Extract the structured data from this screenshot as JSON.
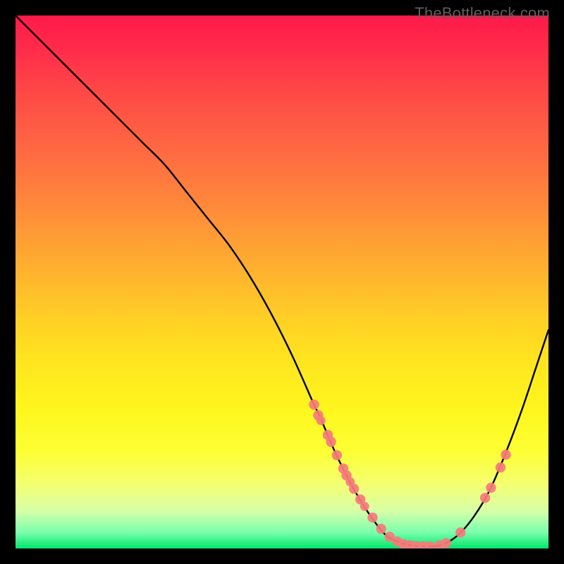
{
  "watermark": "TheBottleneck.com",
  "chart_data": {
    "type": "line",
    "title": "",
    "xlabel": "",
    "ylabel": "",
    "xlim": [
      0,
      100
    ],
    "ylim": [
      0,
      100
    ],
    "series": [
      {
        "name": "curve",
        "x": [
          0,
          4,
          8,
          12,
          16,
          20,
          24,
          28,
          32,
          36,
          40,
          44,
          48,
          52,
          56,
          57,
          60,
          63,
          66,
          69,
          71,
          74,
          77,
          80,
          83,
          86,
          89,
          92,
          95,
          98,
          100
        ],
        "y": [
          100,
          96,
          92,
          88,
          84,
          80,
          76,
          72,
          67,
          62,
          57,
          51,
          44,
          36,
          27,
          25,
          18,
          12,
          7,
          3,
          1.6,
          0.6,
          0.4,
          0.7,
          2.5,
          6,
          11,
          18,
          26,
          35,
          41
        ]
      }
    ],
    "markers": {
      "name": "highlighted-points",
      "color": "#f77a7c",
      "points": [
        {
          "x": 56.0,
          "y": 27.0,
          "r": 1.0
        },
        {
          "x": 56.8,
          "y": 25.0,
          "r": 1.0
        },
        {
          "x": 57.3,
          "y": 24.0,
          "r": 0.9
        },
        {
          "x": 58.6,
          "y": 21.3,
          "r": 1.0
        },
        {
          "x": 59.2,
          "y": 20.0,
          "r": 1.0
        },
        {
          "x": 60.3,
          "y": 17.5,
          "r": 1.0
        },
        {
          "x": 61.5,
          "y": 15.0,
          "r": 1.0
        },
        {
          "x": 62.1,
          "y": 13.7,
          "r": 1.0
        },
        {
          "x": 62.8,
          "y": 12.5,
          "r": 0.9
        },
        {
          "x": 63.5,
          "y": 11.2,
          "r": 1.0
        },
        {
          "x": 64.7,
          "y": 9.2,
          "r": 1.0
        },
        {
          "x": 65.5,
          "y": 7.9,
          "r": 0.9
        },
        {
          "x": 67.0,
          "y": 5.8,
          "r": 1.0
        },
        {
          "x": 68.6,
          "y": 3.7,
          "r": 1.0
        },
        {
          "x": 70.2,
          "y": 2.2,
          "r": 1.0
        },
        {
          "x": 71.6,
          "y": 1.3,
          "r": 1.0
        },
        {
          "x": 72.8,
          "y": 0.8,
          "r": 1.0
        },
        {
          "x": 74.0,
          "y": 0.6,
          "r": 1.0
        },
        {
          "x": 75.2,
          "y": 0.45,
          "r": 1.0
        },
        {
          "x": 76.5,
          "y": 0.4,
          "r": 1.0
        },
        {
          "x": 77.8,
          "y": 0.4,
          "r": 1.0
        },
        {
          "x": 79.6,
          "y": 0.6,
          "r": 1.0
        },
        {
          "x": 80.8,
          "y": 1.0,
          "r": 1.0
        },
        {
          "x": 83.5,
          "y": 3.0,
          "r": 1.0
        },
        {
          "x": 88.1,
          "y": 9.5,
          "r": 1.0
        },
        {
          "x": 89.2,
          "y": 11.4,
          "r": 1.0
        },
        {
          "x": 91.0,
          "y": 15.2,
          "r": 1.0
        },
        {
          "x": 92.0,
          "y": 17.6,
          "r": 1.0
        }
      ]
    },
    "gradient_stops": [
      {
        "pos": 0,
        "color": "#ff1a4a"
      },
      {
        "pos": 14,
        "color": "#ff4747"
      },
      {
        "pos": 36,
        "color": "#ff8a3a"
      },
      {
        "pos": 58,
        "color": "#ffd324"
      },
      {
        "pos": 82,
        "color": "#fdff35"
      },
      {
        "pos": 97,
        "color": "#7affad"
      },
      {
        "pos": 100,
        "color": "#00e66a"
      }
    ]
  }
}
